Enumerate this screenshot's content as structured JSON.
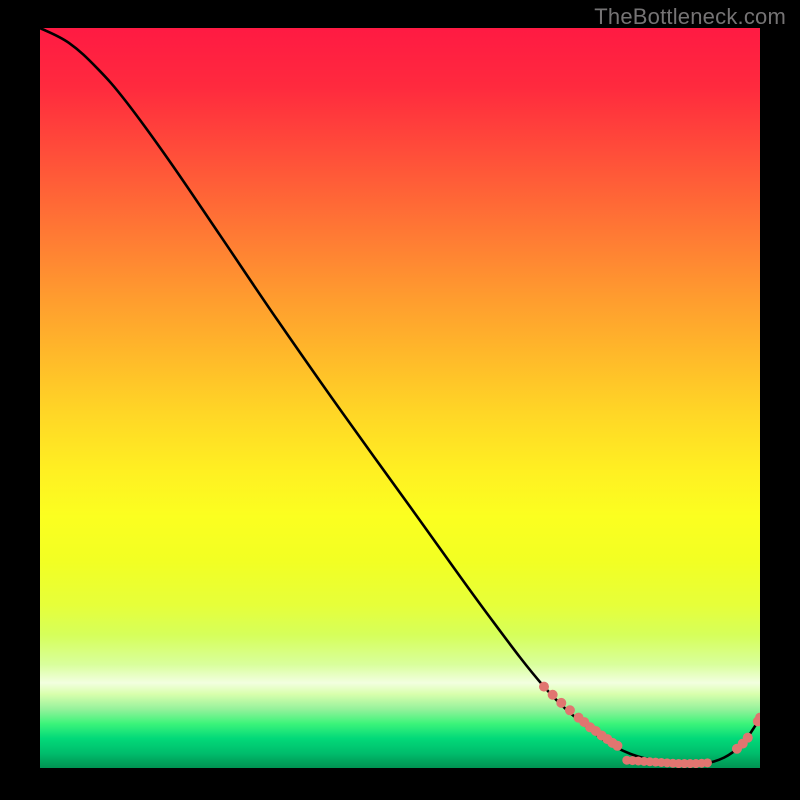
{
  "watermark": "TheBottleneck.com",
  "chart_data": {
    "type": "line",
    "title": "",
    "xlabel": "",
    "ylabel": "",
    "xlim": [
      0,
      100
    ],
    "ylim": [
      0,
      100
    ],
    "grid": false,
    "legend": false,
    "series": [
      {
        "name": "curve",
        "color": "#000000",
        "x": [
          0,
          4,
          8,
          12,
          18,
          25,
          33,
          42,
          52,
          62,
          70,
          76,
          80,
          84,
          88,
          92,
          95,
          97.5,
          99,
          100
        ],
        "y": [
          100,
          98,
          94.5,
          90,
          82,
          72,
          60.5,
          48,
          34.5,
          21,
          11,
          5.5,
          2.8,
          1.3,
          0.6,
          0.6,
          1.4,
          3.2,
          5.2,
          6.8
        ]
      }
    ],
    "markers": [
      {
        "name": "dotted-segment-descent",
        "shape": "circle",
        "color": "#e17570",
        "radius_px": 5,
        "points": [
          {
            "x": 70.0,
            "y": 11.0
          },
          {
            "x": 71.2,
            "y": 9.9
          },
          {
            "x": 72.4,
            "y": 8.8
          },
          {
            "x": 73.6,
            "y": 7.8
          },
          {
            "x": 74.8,
            "y": 6.8
          },
          {
            "x": 75.6,
            "y": 6.2
          },
          {
            "x": 76.4,
            "y": 5.5
          },
          {
            "x": 77.2,
            "y": 5.0
          },
          {
            "x": 78.0,
            "y": 4.4
          },
          {
            "x": 78.8,
            "y": 3.9
          },
          {
            "x": 79.5,
            "y": 3.4
          },
          {
            "x": 80.2,
            "y": 3.0
          }
        ]
      },
      {
        "name": "dotted-segment-trough",
        "shape": "circle",
        "color": "#e17570",
        "radius_px": 4.5,
        "points": [
          {
            "x": 81.5,
            "y": 1.05
          },
          {
            "x": 82.3,
            "y": 1.0
          },
          {
            "x": 83.1,
            "y": 0.95
          },
          {
            "x": 83.9,
            "y": 0.9
          },
          {
            "x": 84.7,
            "y": 0.85
          },
          {
            "x": 85.5,
            "y": 0.8
          },
          {
            "x": 86.3,
            "y": 0.75
          },
          {
            "x": 87.1,
            "y": 0.7
          },
          {
            "x": 87.9,
            "y": 0.65
          },
          {
            "x": 88.7,
            "y": 0.6
          },
          {
            "x": 89.5,
            "y": 0.6
          },
          {
            "x": 90.3,
            "y": 0.6
          },
          {
            "x": 91.1,
            "y": 0.6
          },
          {
            "x": 91.9,
            "y": 0.65
          },
          {
            "x": 92.7,
            "y": 0.7
          }
        ]
      },
      {
        "name": "dotted-segment-rise",
        "shape": "circle",
        "color": "#e17570",
        "radius_px": 5,
        "points": [
          {
            "x": 96.8,
            "y": 2.6
          },
          {
            "x": 97.6,
            "y": 3.3
          },
          {
            "x": 98.3,
            "y": 4.1
          },
          {
            "x": 99.7,
            "y": 6.3
          },
          {
            "x": 100.0,
            "y": 6.8
          }
        ]
      }
    ],
    "gradient_stops": [
      {
        "pos": 0.0,
        "color": "#ff1a43"
      },
      {
        "pos": 0.5,
        "color": "#ffc028"
      },
      {
        "pos": 0.7,
        "color": "#f8ff22"
      },
      {
        "pos": 0.88,
        "color": "#f2ffe0"
      },
      {
        "pos": 1.0,
        "color": "#009252"
      }
    ]
  }
}
